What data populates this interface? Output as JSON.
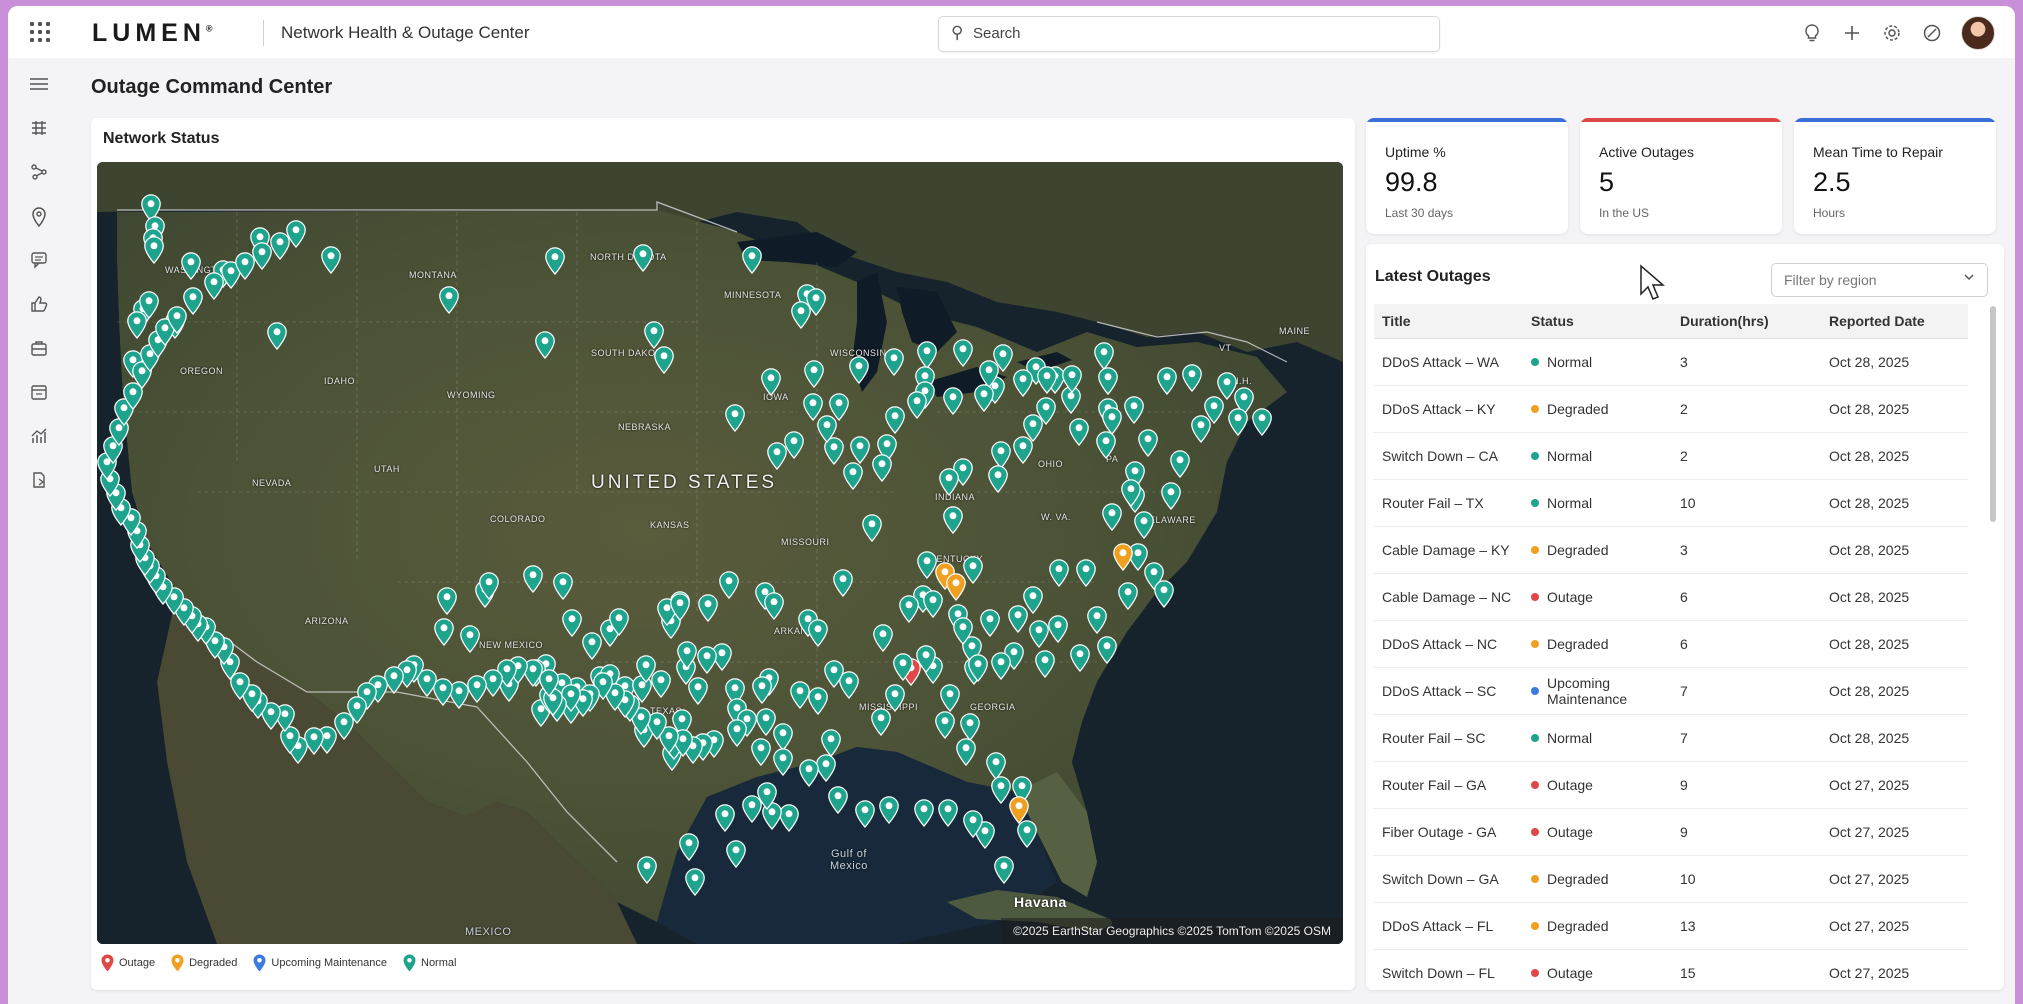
{
  "app": {
    "logo": "LUMEN",
    "logo_mark": "®",
    "title": "Network Health & Outage Center"
  },
  "search": {
    "placeholder": "Search"
  },
  "topbar_icons": [
    "lightbulb-icon",
    "plus-icon",
    "gear-icon",
    "help-icon",
    "avatar"
  ],
  "rail_icons": [
    "menu-icon",
    "network-icon",
    "topology-icon",
    "location-icon",
    "chat-icon",
    "thumbs-up-icon",
    "briefcase-icon",
    "calendar-icon",
    "analytics-icon",
    "report-icon"
  ],
  "page": {
    "title": "Outage Command Center"
  },
  "map": {
    "title": "Network Status",
    "attribution": "©2025 EarthStar Geographics ©2025 TomTom ©2025 OSM",
    "labels": {
      "country": "UNITED STATES",
      "mexico": "MEXICO",
      "gulf": "Gulf of\nMexico",
      "havana": "Havana",
      "states": [
        "WASHINGTON",
        "MONTANA",
        "NORTH DAKOTA",
        "MINNESOTA",
        "SOUTH DAKOTA",
        "OREGON",
        "IDAHO",
        "WYOMING",
        "WISCONSIN",
        "NEBRASKA",
        "IOWA",
        "NEVADA",
        "UTAH",
        "COLORADO",
        "KANSAS",
        "MISSOURI",
        "KENTUCKY",
        "ARIZONA",
        "NEW MEXICO",
        "TEXAS",
        "ARKANSAS",
        "MISSISSIPPI",
        "GEORGIA",
        "OHIO",
        "INDIANA",
        "PA",
        "W. VA.",
        "DELAWARE",
        "MAINE",
        "VT",
        "N.H."
      ]
    },
    "legend": [
      {
        "label": "Outage",
        "color": "#e04848"
      },
      {
        "label": "Degraded",
        "color": "#f0a020"
      },
      {
        "label": "Upcoming Maintenance",
        "color": "#3b7be0"
      },
      {
        "label": "Normal",
        "color": "#1ea38c"
      }
    ]
  },
  "kpis": [
    {
      "label": "Uptime %",
      "value": "99.8",
      "sub": "Last 30 days",
      "color": "#3b6fd6"
    },
    {
      "label": "Active Outages",
      "value": "5",
      "sub": "In the US",
      "color": "#e04848"
    },
    {
      "label": "Mean Time to Repair",
      "value": "2.5",
      "sub": "Hours",
      "color": "#3b6fd6"
    }
  ],
  "outages": {
    "title": "Latest Outages",
    "filter_placeholder": "Filter by region",
    "columns": [
      "Title",
      "Status",
      "Duration(hrs)",
      "Reported Date"
    ],
    "status_colors": {
      "Normal": "#1ea38c",
      "Degraded": "#f0a020",
      "Outage": "#e04848",
      "Upcoming Maintenance": "#3b7be0"
    },
    "rows": [
      {
        "title": "DDoS Attack – WA",
        "status": "Normal",
        "duration": "3",
        "date": "Oct 28, 2025"
      },
      {
        "title": "DDoS Attack – KY",
        "status": "Degraded",
        "duration": "2",
        "date": "Oct 28, 2025"
      },
      {
        "title": "Switch Down – CA",
        "status": "Normal",
        "duration": "2",
        "date": "Oct 28, 2025"
      },
      {
        "title": "Router Fail – TX",
        "status": "Normal",
        "duration": "10",
        "date": "Oct 28, 2025"
      },
      {
        "title": "Cable Damage – KY",
        "status": "Degraded",
        "duration": "3",
        "date": "Oct 28, 2025"
      },
      {
        "title": "Cable Damage – NC",
        "status": "Outage",
        "duration": "6",
        "date": "Oct 28, 2025"
      },
      {
        "title": "DDoS Attack – NC",
        "status": "Degraded",
        "duration": "6",
        "date": "Oct 28, 2025"
      },
      {
        "title": "DDoS Attack – SC",
        "status": "Upcoming Maintenance",
        "duration": "7",
        "date": "Oct 28, 2025"
      },
      {
        "title": "Router Fail – SC",
        "status": "Normal",
        "duration": "7",
        "date": "Oct 28, 2025"
      },
      {
        "title": "Router Fail – GA",
        "status": "Outage",
        "duration": "9",
        "date": "Oct 27, 2025"
      },
      {
        "title": "Fiber Outage - GA",
        "status": "Outage",
        "duration": "9",
        "date": "Oct 27, 2025"
      },
      {
        "title": "Switch Down – GA",
        "status": "Degraded",
        "duration": "10",
        "date": "Oct 27, 2025"
      },
      {
        "title": "DDoS Attack – FL",
        "status": "Degraded",
        "duration": "13",
        "date": "Oct 27, 2025"
      },
      {
        "title": "Switch Down – FL",
        "status": "Outage",
        "duration": "15",
        "date": "Oct 27, 2025"
      }
    ]
  }
}
